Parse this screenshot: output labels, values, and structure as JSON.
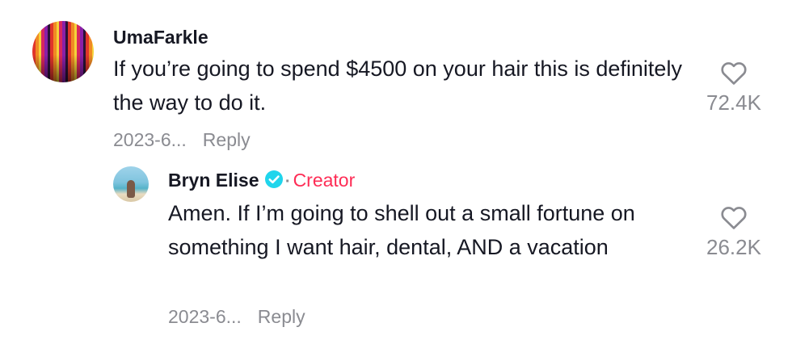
{
  "comments": [
    {
      "username": "UmaFarkle",
      "text": "If you’re going to spend $4500 on your hair this is definitely the way to do it.",
      "date": "2023-6...",
      "reply_label": "Reply",
      "likes": "72.4K",
      "avatar_icon": "rainbow-avatar"
    }
  ],
  "replies": [
    {
      "username": "Bryn Elise",
      "badge_icon": "verified-check-icon",
      "badge_separator": "·",
      "creator_label": "Creator",
      "text": "Amen. If I’m going to shell out a small fortune on something I want hair, dental, AND a vacation",
      "date": "2023-6...",
      "reply_label": "Reply",
      "likes": "26.2K",
      "avatar_icon": "beach-avatar"
    }
  ],
  "colors": {
    "text": "#161823",
    "muted": "#8a8b91",
    "creator": "#fe2c55",
    "verified": "#20d5ec"
  }
}
